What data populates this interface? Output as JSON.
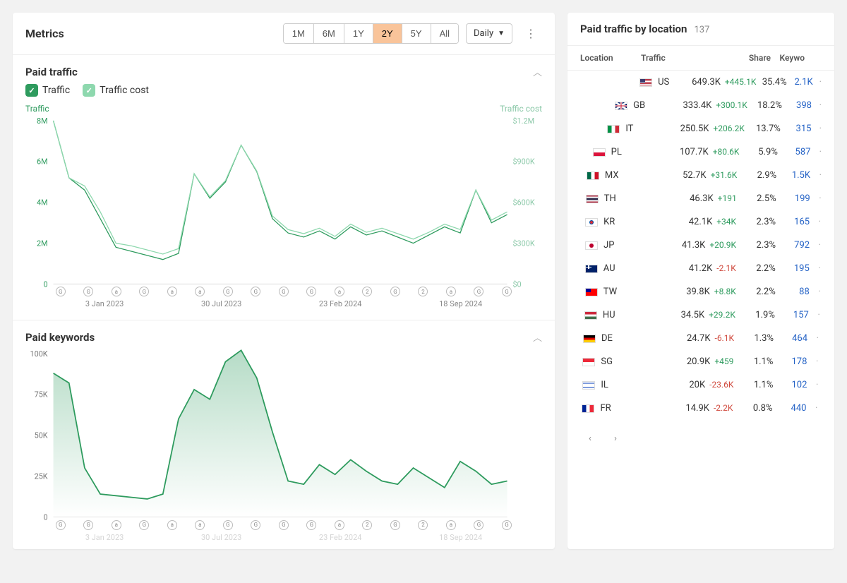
{
  "metrics_title": "Metrics",
  "range_options": [
    "1M",
    "6M",
    "1Y",
    "2Y",
    "5Y",
    "All"
  ],
  "range_active": "2Y",
  "granularity": "Daily",
  "paid_traffic": {
    "title": "Paid traffic",
    "legend_traffic": "Traffic",
    "legend_cost": "Traffic cost",
    "y_left_label": "Traffic",
    "y_right_label": "Traffic cost"
  },
  "paid_keywords": {
    "title": "Paid keywords"
  },
  "side": {
    "title": "Paid traffic by location",
    "count": "137",
    "cols": {
      "loc": "Location",
      "traf": "Traffic",
      "share": "Share",
      "kw": "Keywo"
    },
    "rows": [
      {
        "flag": "us",
        "code": "US",
        "traffic": "649.3K",
        "delta": "+445.1K",
        "delta_sign": "pos",
        "share": "35.4%",
        "share_pct": 35.4,
        "kw": "2.1K"
      },
      {
        "flag": "gb",
        "code": "GB",
        "traffic": "333.4K",
        "delta": "+300.1K",
        "delta_sign": "pos",
        "share": "18.2%",
        "share_pct": 18.2,
        "kw": "398"
      },
      {
        "flag": "it",
        "code": "IT",
        "traffic": "250.5K",
        "delta": "+206.2K",
        "delta_sign": "pos",
        "share": "13.7%",
        "share_pct": 13.7,
        "kw": "315"
      },
      {
        "flag": "pl",
        "code": "PL",
        "traffic": "107.7K",
        "delta": "+80.6K",
        "delta_sign": "pos",
        "share": "5.9%",
        "share_pct": 5.9,
        "kw": "587"
      },
      {
        "flag": "mx",
        "code": "MX",
        "traffic": "52.7K",
        "delta": "+31.6K",
        "delta_sign": "pos",
        "share": "2.9%",
        "share_pct": 2.9,
        "kw": "1.5K"
      },
      {
        "flag": "th",
        "code": "TH",
        "traffic": "46.3K",
        "delta": "+191",
        "delta_sign": "pos",
        "share": "2.5%",
        "share_pct": 2.5,
        "kw": "199"
      },
      {
        "flag": "kr",
        "code": "KR",
        "traffic": "42.1K",
        "delta": "+34K",
        "delta_sign": "pos",
        "share": "2.3%",
        "share_pct": 2.3,
        "kw": "165"
      },
      {
        "flag": "jp",
        "code": "JP",
        "traffic": "41.3K",
        "delta": "+20.9K",
        "delta_sign": "pos",
        "share": "2.3%",
        "share_pct": 2.3,
        "kw": "792"
      },
      {
        "flag": "au",
        "code": "AU",
        "traffic": "41.2K",
        "delta": "-2.1K",
        "delta_sign": "neg",
        "share": "2.2%",
        "share_pct": 2.2,
        "kw": "195"
      },
      {
        "flag": "tw",
        "code": "TW",
        "traffic": "39.8K",
        "delta": "+8.8K",
        "delta_sign": "pos",
        "share": "2.2%",
        "share_pct": 2.2,
        "kw": "88"
      },
      {
        "flag": "hu",
        "code": "HU",
        "traffic": "34.5K",
        "delta": "+29.2K",
        "delta_sign": "pos",
        "share": "1.9%",
        "share_pct": 1.9,
        "kw": "157"
      },
      {
        "flag": "de",
        "code": "DE",
        "traffic": "24.7K",
        "delta": "-6.1K",
        "delta_sign": "neg",
        "share": "1.3%",
        "share_pct": 1.3,
        "kw": "464"
      },
      {
        "flag": "sg",
        "code": "SG",
        "traffic": "20.9K",
        "delta": "+459",
        "delta_sign": "pos",
        "share": "1.1%",
        "share_pct": 1.1,
        "kw": "178"
      },
      {
        "flag": "il",
        "code": "IL",
        "traffic": "20K",
        "delta": "-23.6K",
        "delta_sign": "neg",
        "share": "1.1%",
        "share_pct": 1.1,
        "kw": "102"
      },
      {
        "flag": "fr",
        "code": "FR",
        "traffic": "14.9K",
        "delta": "-2.2K",
        "delta_sign": "neg",
        "share": "0.8%",
        "share_pct": 0.8,
        "kw": "440"
      }
    ]
  },
  "chart_data": [
    {
      "type": "line",
      "title": "Paid traffic",
      "x_ticks": [
        "3 Jan 2023",
        "30 Jul 2023",
        "23 Feb 2024",
        "18 Sep 2024"
      ],
      "y_left_ticks": [
        "8M",
        "6M",
        "4M",
        "2M",
        "0"
      ],
      "y_right_ticks": [
        "$1.2M",
        "$900K",
        "$600K",
        "$300K",
        "$0"
      ],
      "ylim_left": [
        0,
        8000000
      ],
      "ylim_right": [
        0,
        1200000
      ],
      "series": [
        {
          "name": "Traffic",
          "axis": "left",
          "values": [
            8000000,
            5200000,
            4600000,
            3200000,
            1800000,
            1600000,
            1400000,
            1200000,
            1500000,
            5400000,
            4200000,
            5000000,
            6800000,
            5500000,
            3200000,
            2500000,
            2300000,
            2600000,
            2200000,
            2800000,
            2400000,
            2600000,
            2300000,
            2000000,
            2400000,
            2800000,
            2500000,
            4600000,
            3000000,
            3400000
          ]
        },
        {
          "name": "Traffic cost",
          "axis": "right",
          "values": [
            1200000,
            780000,
            720000,
            530000,
            300000,
            280000,
            250000,
            220000,
            260000,
            810000,
            640000,
            760000,
            1020000,
            830000,
            500000,
            400000,
            370000,
            410000,
            350000,
            440000,
            380000,
            410000,
            370000,
            330000,
            380000,
            440000,
            400000,
            690000,
            470000,
            530000
          ]
        }
      ],
      "markers": [
        "G",
        "G",
        "a",
        "G",
        "a",
        "a",
        "G",
        "G",
        "G",
        "G",
        "a",
        "2",
        "G",
        "2",
        "a",
        "G",
        "G"
      ]
    },
    {
      "type": "area",
      "title": "Paid keywords",
      "x_ticks": [
        "3 Jan 2023",
        "30 Jul 2023",
        "23 Feb 2024",
        "18 Sep 2024"
      ],
      "y_ticks": [
        "100K",
        "75K",
        "50K",
        "25K",
        "0"
      ],
      "ylim": [
        0,
        100000
      ],
      "series": [
        {
          "name": "Keywords",
          "values": [
            88000,
            82000,
            30000,
            14000,
            13000,
            12000,
            11000,
            14000,
            60000,
            78000,
            72000,
            95000,
            102000,
            85000,
            52000,
            22000,
            20000,
            32000,
            26000,
            35000,
            28000,
            22000,
            20000,
            30000,
            24000,
            18000,
            34000,
            28000,
            20000,
            22000
          ]
        }
      ]
    }
  ]
}
